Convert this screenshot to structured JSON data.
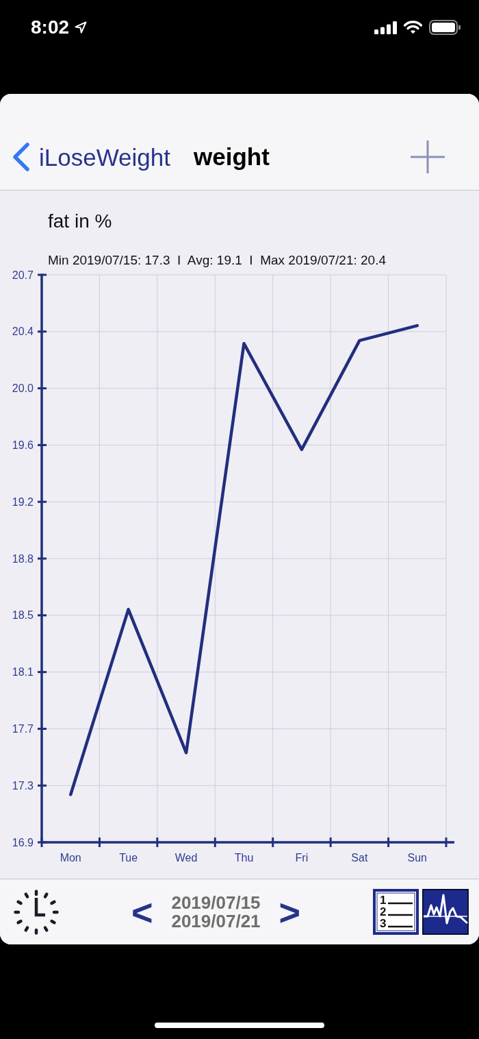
{
  "status_bar": {
    "time": "8:02"
  },
  "nav": {
    "back_label": "iLoseWeight",
    "title": "weight"
  },
  "chart": {
    "summary": "Min 2019/07/15: 17.3  I  Avg: 19.1  I  Max 2019/07/21: 20.4",
    "chart_data": {
      "type": "line",
      "title": "fat in %",
      "grid": true,
      "categories": [
        "Mon",
        "Tue",
        "Wed",
        "Thu",
        "Fri",
        "Sat",
        "Sun"
      ],
      "ylim": [
        16.94,
        20.74
      ],
      "yticks": [
        {
          "value": 16.94,
          "label": "16.9"
        },
        {
          "value": 17.32,
          "label": "17.3"
        },
        {
          "value": 17.7,
          "label": "17.7"
        },
        {
          "value": 18.08,
          "label": "18.1"
        },
        {
          "value": 18.46,
          "label": "18.5"
        },
        {
          "value": 18.84,
          "label": "18.8"
        },
        {
          "value": 19.22,
          "label": "19.2"
        },
        {
          "value": 19.6,
          "label": "19.6"
        },
        {
          "value": 19.98,
          "label": "20.0"
        },
        {
          "value": 20.36,
          "label": "20.4"
        },
        {
          "value": 20.74,
          "label": "20.7"
        }
      ],
      "series": [
        {
          "color": "#222e7e",
          "values": [
            17.26,
            18.5,
            17.54,
            20.28,
            19.57,
            20.3,
            20.4
          ]
        }
      ]
    }
  },
  "toolbar": {
    "prev": "<",
    "range_start": "2019/07/15",
    "range_end": "2019/07/21",
    "next": ">",
    "list_digits": [
      "1",
      "2",
      "3"
    ]
  }
}
